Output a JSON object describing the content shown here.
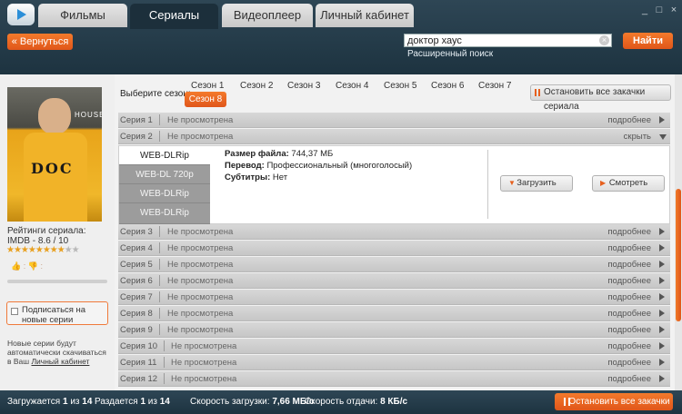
{
  "nav": {
    "tabs": [
      {
        "label": "Фильмы"
      },
      {
        "label": "Сериалы"
      },
      {
        "label": "Видеоплеер"
      },
      {
        "label": "Личный кабинет"
      }
    ],
    "back_label": "Вернуться",
    "search_value": "доктор хаус",
    "advanced_search": "Расширенный поиск",
    "find_label": "Найти",
    "window_controls": [
      "_",
      "□",
      "×"
    ]
  },
  "sidebar": {
    "rating_label": "Рейтинги сериала:",
    "imdb": "IMDB - 8.6 / 10",
    "stars_on": "★★★★★★★★",
    "stars_off": "★★",
    "subscribe_text": "Подписаться на новые серии",
    "note_text": "Новые серии будут автоматически скачиваться в Ваш ",
    "note_link": "Личный кабинет"
  },
  "seasons": {
    "label": "Выберите сезон:",
    "items": [
      "Сезон 1",
      "Сезон 2",
      "Сезон 3",
      "Сезон 4",
      "Сезон 5",
      "Сезон 6",
      "Сезон 7"
    ],
    "active": "Сезон 8",
    "stop_label": "Остановить все закачки сериала"
  },
  "episodes": {
    "more": "подробнее",
    "hide": "скрыть",
    "list": [
      {
        "name": "Серия 1",
        "status": "Не просмотрена"
      },
      {
        "name": "Серия 2",
        "status": "Не просмотрена"
      },
      {
        "name": "Серия 3",
        "status": "Не просмотрена"
      },
      {
        "name": "Серия 4",
        "status": "Не просмотрена"
      },
      {
        "name": "Серия 5",
        "status": "Не просмотрена"
      },
      {
        "name": "Серия 6",
        "status": "Не просмотрена"
      },
      {
        "name": "Серия 7",
        "status": "Не просмотрена"
      },
      {
        "name": "Серия 8",
        "status": "Не просмотрена"
      },
      {
        "name": "Серия 9",
        "status": "Не просмотрена"
      },
      {
        "name": "Серия 10",
        "status": "Не просмотрена"
      },
      {
        "name": "Серия 11",
        "status": "Не просмотрена"
      },
      {
        "name": "Серия 12",
        "status": "Не просмотрена"
      }
    ]
  },
  "details": {
    "qualities": [
      "WEB-DLRip",
      "WEB-DL 720p",
      "WEB-DLRip",
      "WEB-DLRip"
    ],
    "size_label": "Размер файла:",
    "size_value": "744,37 МБ",
    "translation_label": "Перевод:",
    "translation_value": "Профессиональный (многоголосый)",
    "subs_label": "Субтитры:",
    "subs_value": "Нет",
    "download_label": "Загрузить",
    "watch_label": "Смотреть"
  },
  "status": {
    "loading_prefix": "Загружается",
    "loading_value": "1",
    "loading_of": "из",
    "loading_total": "14",
    "seeding_prefix": "Раздается",
    "seeding_value": "1",
    "seeding_of": "из",
    "seeding_total": "14",
    "dl_speed_label": "Скорость загрузки:",
    "dl_speed_value": "7,66 МБ/с",
    "ul_speed_label": "Скорость отдачи:",
    "ul_speed_value": "8 КБ/с",
    "stop_all_label": "Остановить все закачки"
  }
}
